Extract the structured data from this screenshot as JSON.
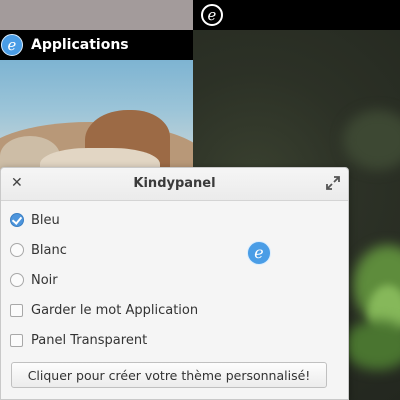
{
  "left_preview": {
    "panel_label": "Applications"
  },
  "dialog": {
    "title": "Kindypanel",
    "options": [
      {
        "label": "Bleu",
        "type": "radio",
        "checked": true
      },
      {
        "label": "Blanc",
        "type": "radio",
        "checked": false
      },
      {
        "label": "Noir",
        "type": "radio",
        "checked": false
      },
      {
        "label": "Garder le mot Application",
        "type": "checkbox",
        "checked": false
      },
      {
        "label": "Panel Transparent",
        "type": "checkbox",
        "checked": false
      }
    ],
    "button_label": "Cliquer pour créer votre thème personnalisé!"
  },
  "icons": {
    "close": "close-icon",
    "maximize": "maximize-icon",
    "logo": "elementary-logo-icon"
  },
  "colors": {
    "accent": "#4d95dc",
    "panel_black": "#000000",
    "dialog_bg": "#f5f5f5",
    "desktop_bg": "#a39b9b"
  }
}
